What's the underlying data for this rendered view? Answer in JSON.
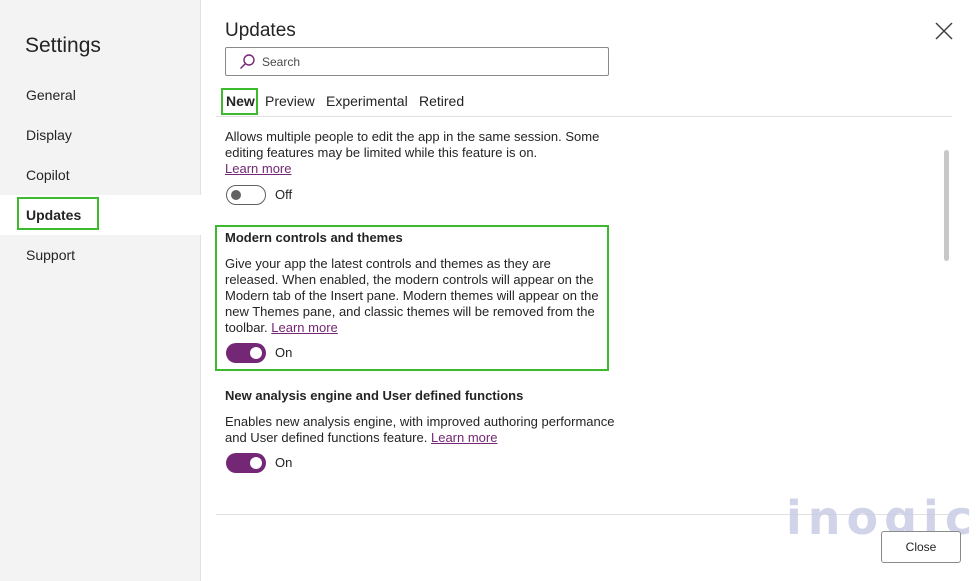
{
  "sidebar": {
    "title": "Settings",
    "items": [
      {
        "label": "General"
      },
      {
        "label": "Display"
      },
      {
        "label": "Copilot"
      },
      {
        "label": "Updates"
      },
      {
        "label": "Support"
      }
    ]
  },
  "main": {
    "title": "Updates",
    "search": {
      "placeholder": "Search",
      "value": ""
    },
    "tabs": [
      {
        "label": "New"
      },
      {
        "label": "Preview"
      },
      {
        "label": "Experimental"
      },
      {
        "label": "Retired"
      }
    ],
    "features": [
      {
        "title": "",
        "description": "Allows multiple people to edit the app in the same session. Some editing features may be limited while this feature is on.",
        "link": "Learn more",
        "state": "Off"
      },
      {
        "title": "Modern controls and themes",
        "description": "Give your app the latest controls and themes as they are released. When enabled, the modern controls will appear on the Modern tab of the Insert pane. Modern themes will appear on the new Themes pane, and classic themes will be removed from the toolbar.",
        "link": "Learn more",
        "state": "On"
      },
      {
        "title": "New analysis engine and User defined functions",
        "description": "Enables new analysis engine, with improved authoring performance and User defined functions feature.",
        "link": "Learn more",
        "state": "On"
      }
    ]
  },
  "footer": {
    "close_label": "Close"
  },
  "watermark": "inogic",
  "colors": {
    "accent": "#742774",
    "highlight": "#3dbb2f",
    "sidebar_bg": "#f3f3f3"
  }
}
